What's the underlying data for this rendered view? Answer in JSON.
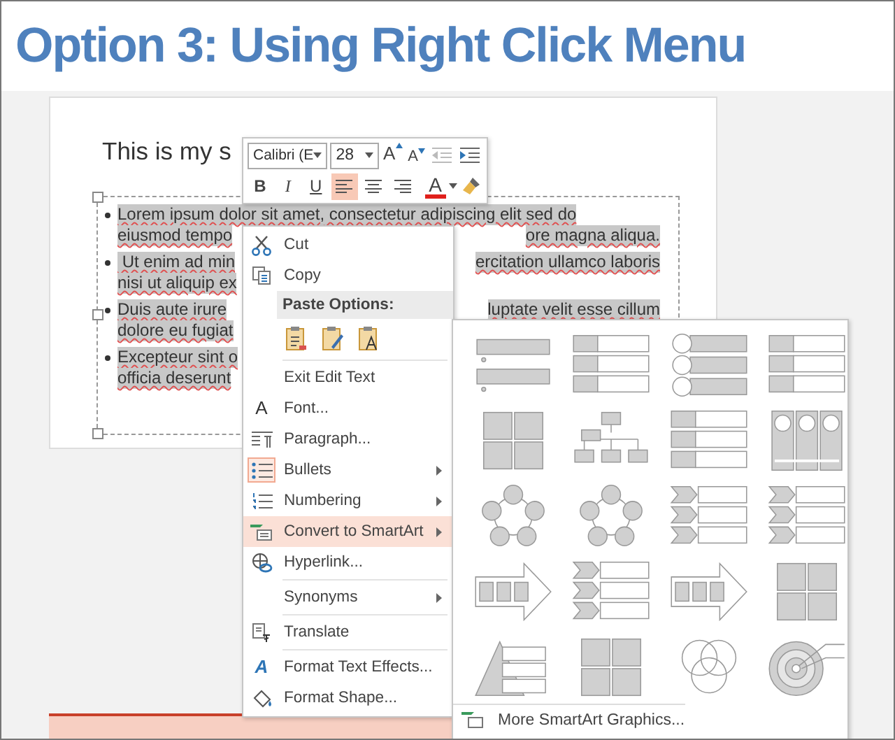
{
  "title": "Option 3: Using Right Click Menu",
  "slide": {
    "title": "This is my s",
    "bullets": [
      {
        "lines": [
          {
            "left": "Lorem ipsum dolor sit amet, consectetur adipiscing elit sed do"
          },
          {
            "left": "eiusmod tempo",
            "right": "ore magna aliqua."
          }
        ]
      },
      {
        "lines": [
          {
            "left": " Ut enim ad min",
            "right": "ercitation ullamco laboris"
          },
          {
            "left": "nisi ut aliquip ex"
          }
        ]
      },
      {
        "lines": [
          {
            "left": "Duis aute irure",
            "right": "luptate velit esse cillum"
          },
          {
            "left": "dolore eu fugiat"
          }
        ]
      },
      {
        "lines": [
          {
            "left": "Excepteur sint o"
          },
          {
            "left": "officia deserunt"
          }
        ]
      }
    ]
  },
  "mini_toolbar": {
    "font": "Calibri (E",
    "size": "28",
    "grow_font": "A",
    "shrink_font": "A",
    "styles": [
      "B",
      "I",
      "U"
    ],
    "alignments": [
      {
        "selected": true
      },
      {
        "selected": false
      },
      {
        "selected": false
      }
    ],
    "font_color": "A"
  },
  "context_menu": [
    {
      "kind": "item",
      "label": "Cut",
      "selected": false
    },
    {
      "kind": "item",
      "label": "Copy",
      "selected": false
    },
    {
      "kind": "header",
      "label": "Paste Options:"
    },
    {
      "kind": "paste_row"
    },
    {
      "kind": "separator"
    },
    {
      "kind": "item",
      "label": "Exit Edit Text",
      "selected": false
    },
    {
      "kind": "item",
      "label": "Font...",
      "icon_text": "A",
      "selected": false
    },
    {
      "kind": "item",
      "label": "Paragraph...",
      "selected": false
    },
    {
      "kind": "item",
      "label": "Bullets",
      "submenu": true,
      "checked": true,
      "selected": false
    },
    {
      "kind": "item",
      "label": "Numbering",
      "submenu": true,
      "checked": false,
      "selected": false
    },
    {
      "kind": "item",
      "label": "Convert to SmartArt",
      "submenu": true,
      "selected": true
    },
    {
      "kind": "item",
      "label": "Hyperlink...",
      "selected": false
    },
    {
      "kind": "separator"
    },
    {
      "kind": "item",
      "label": "Synonyms",
      "submenu": true,
      "selected": false
    },
    {
      "kind": "separator"
    },
    {
      "kind": "item",
      "label": "Translate",
      "selected": false
    },
    {
      "kind": "separator"
    },
    {
      "kind": "item",
      "label": "Format Text Effects...",
      "icon_text": "A",
      "selected": false
    },
    {
      "kind": "item",
      "label": "Format Shape...",
      "selected": false
    }
  ],
  "smartart_gallery": {
    "footer": "More SmartArt Graphics..."
  }
}
